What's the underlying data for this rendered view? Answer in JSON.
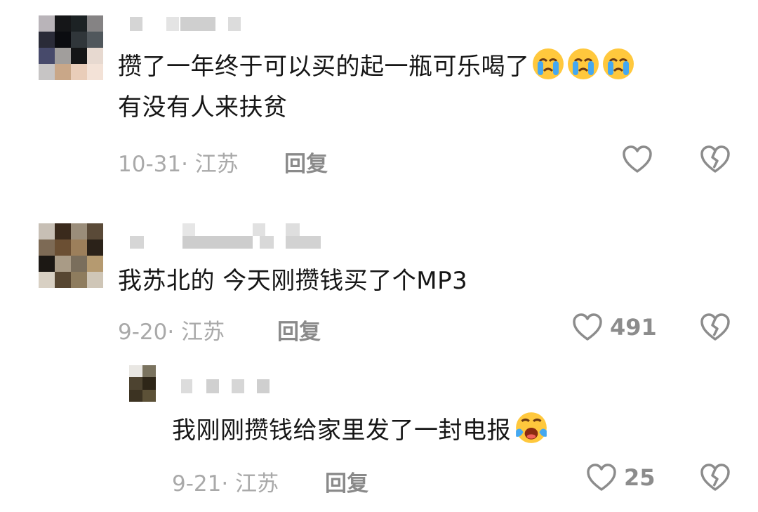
{
  "comments": [
    {
      "text_line1": "攒了一年终于可以买的起一瓶可乐喝了",
      "text_line2": "有没有人来扶贫",
      "emojis": [
        "crying-face",
        "crying-face",
        "crying-face"
      ],
      "date_location": "10-31· 江苏",
      "reply_label": "回复",
      "like_count": ""
    },
    {
      "text_line1": "我苏北的 今天刚攒钱买了个MP3",
      "date_location": "9-20· 江苏",
      "reply_label": "回复",
      "like_count": "491",
      "replies": [
        {
          "text_line1": "我刚刚攒钱给家里发了一封电报",
          "emojis": [
            "loudly-crying-face"
          ],
          "date_location": "9-21· 江苏",
          "reply_label": "回复",
          "like_count": "25"
        }
      ]
    }
  ],
  "colors": {
    "text": "#161616",
    "meta": "#a9a9a9",
    "reply": "#8a8a8a",
    "icon": "#8c8c8c",
    "emoji_face": "#ffc83d",
    "tears": "#45a8f0"
  },
  "icons": {
    "like": "heart-outline-icon",
    "dislike": "broken-heart-icon"
  }
}
